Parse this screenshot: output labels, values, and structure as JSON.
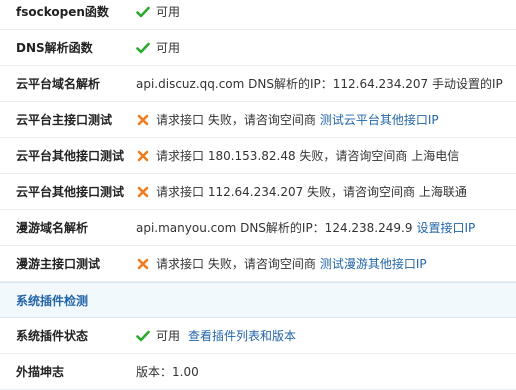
{
  "rows": [
    {
      "label": "fsockopen函数",
      "status": "ok",
      "text": "可用"
    },
    {
      "label": "DNS解析函数",
      "status": "ok",
      "text": "可用"
    },
    {
      "label": "云平台域名解析",
      "text": "api.discuz.qq.com DNS解析的IP：112.64.234.207 手动设置的IP"
    },
    {
      "label": "云平台主接口测试",
      "status": "fail",
      "text": "请求接口 失败，请咨询空间商",
      "link": "测试云平台其他接口IP"
    },
    {
      "label": "云平台其他接口测试",
      "status": "fail",
      "text": "请求接口 180.153.82.48 失败，请咨询空间商 上海电信"
    },
    {
      "label": "云平台其他接口测试",
      "status": "fail",
      "text": "请求接口 112.64.234.207 失败，请咨询空间商 上海联通"
    },
    {
      "label": "漫游域名解析",
      "text": "api.manyou.com DNS解析的IP：124.238.249.9",
      "link": "设置接口IP"
    },
    {
      "label": "漫游主接口测试",
      "status": "fail",
      "text": "请求接口 失败，请咨询空间商",
      "link": "测试漫游其他接口IP"
    }
  ],
  "section": {
    "title": "系统插件检测"
  },
  "plugin_rows": [
    {
      "label": "系统插件状态",
      "status": "ok",
      "text": "可用",
      "link": "查看插件列表和版本"
    },
    {
      "label": "外描坤志",
      "text": "版本：1.00"
    }
  ],
  "colors": {
    "ok": "#2fa82f",
    "fail": "#f07c1b",
    "link": "#2366a8",
    "section_bg": "#f2f9fd"
  }
}
